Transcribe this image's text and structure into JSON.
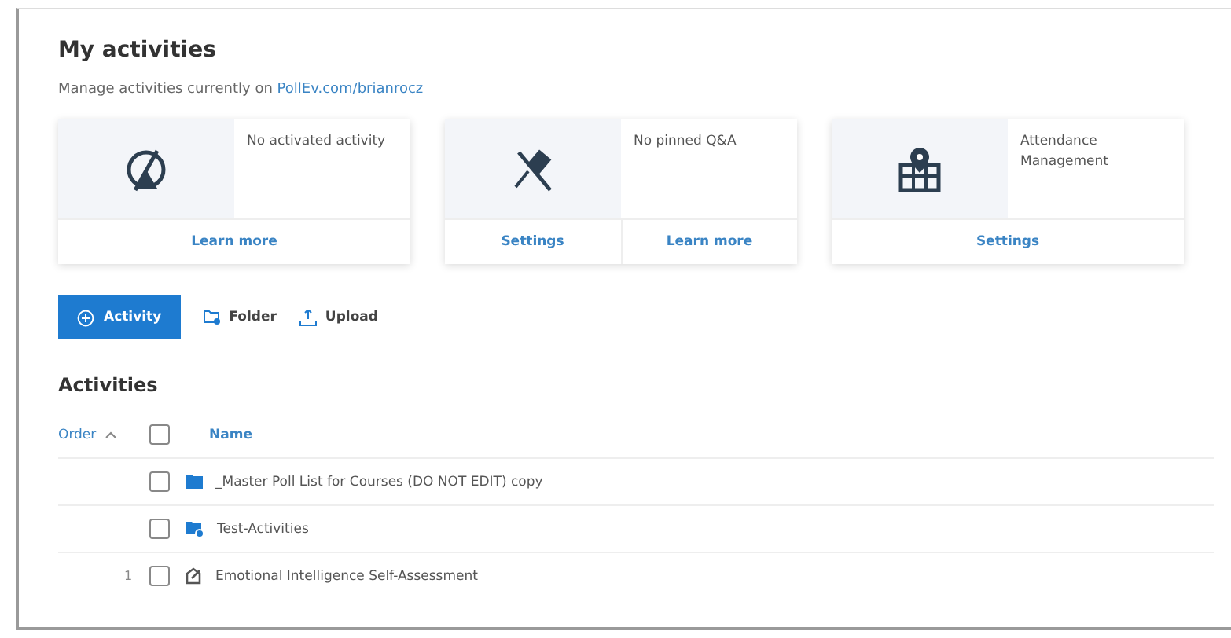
{
  "header": {
    "title": "My activities",
    "subtitle": "Manage activities currently on ",
    "subtitle_link": "PollEv.com/brianrocz"
  },
  "cards": [
    {
      "kind": "activity",
      "text": "No activated activity",
      "actions": [
        "Learn more"
      ]
    },
    {
      "kind": "pin",
      "text": "No pinned Q&A",
      "actions": [
        "Settings",
        "Learn more"
      ]
    },
    {
      "kind": "attendance",
      "text": "Attendance Management",
      "actions": [
        "Settings"
      ]
    }
  ],
  "toolbar": {
    "primary": "Activity",
    "folder": "Folder",
    "upload": "Upload"
  },
  "activities": {
    "title": "Activities",
    "columns": {
      "order": "Order",
      "name": "Name"
    },
    "select_all_checked": false,
    "rows": [
      {
        "kind": "folder",
        "order": "",
        "name": "_Master Poll List for Courses (DO NOT EDIT) copy",
        "checked": false
      },
      {
        "kind": "shared-folder",
        "order": "",
        "name": "Test-Activities",
        "checked": false
      },
      {
        "kind": "survey",
        "order": "1",
        "name": "Emotional Intelligence Self-Assessment",
        "checked": false
      }
    ]
  }
}
